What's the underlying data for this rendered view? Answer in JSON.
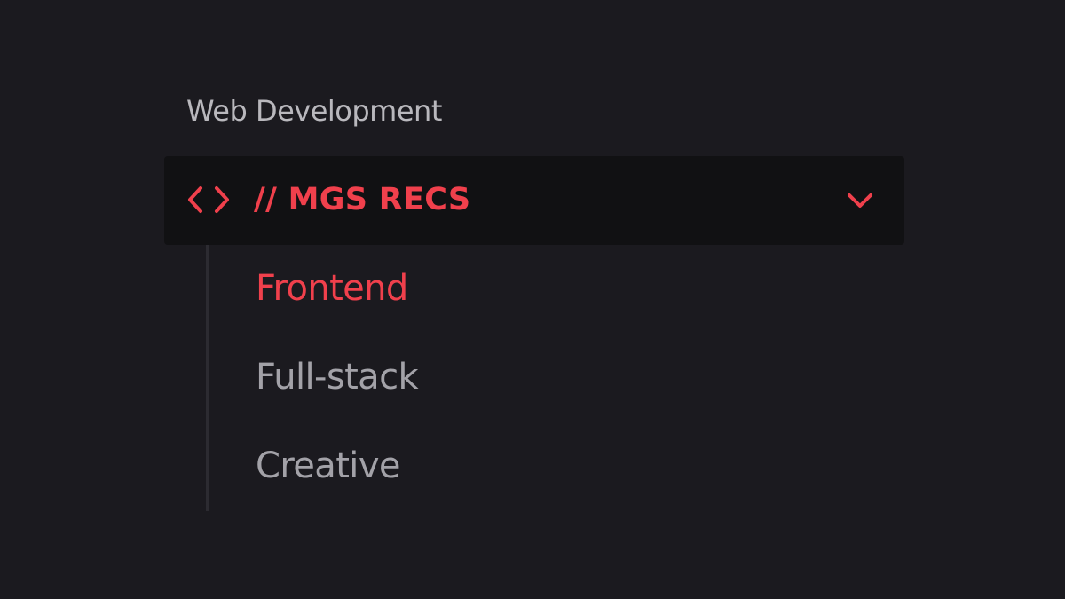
{
  "colors": {
    "background": "#1b1a1f",
    "panel": "#111113",
    "accent": "#f0404c",
    "muted_text": "#a3a2a8",
    "title_text": "#b9b8bd",
    "tree_line": "#2c2b31"
  },
  "section": {
    "title": "Web Development"
  },
  "nav_group": {
    "icon": "code-icon",
    "title": "// MGS RECS",
    "toggle_icon": "chevron-down-icon",
    "expanded": true,
    "items": [
      {
        "label": "Frontend",
        "active": true
      },
      {
        "label": "Full-stack",
        "active": false
      },
      {
        "label": "Creative",
        "active": false
      }
    ]
  }
}
